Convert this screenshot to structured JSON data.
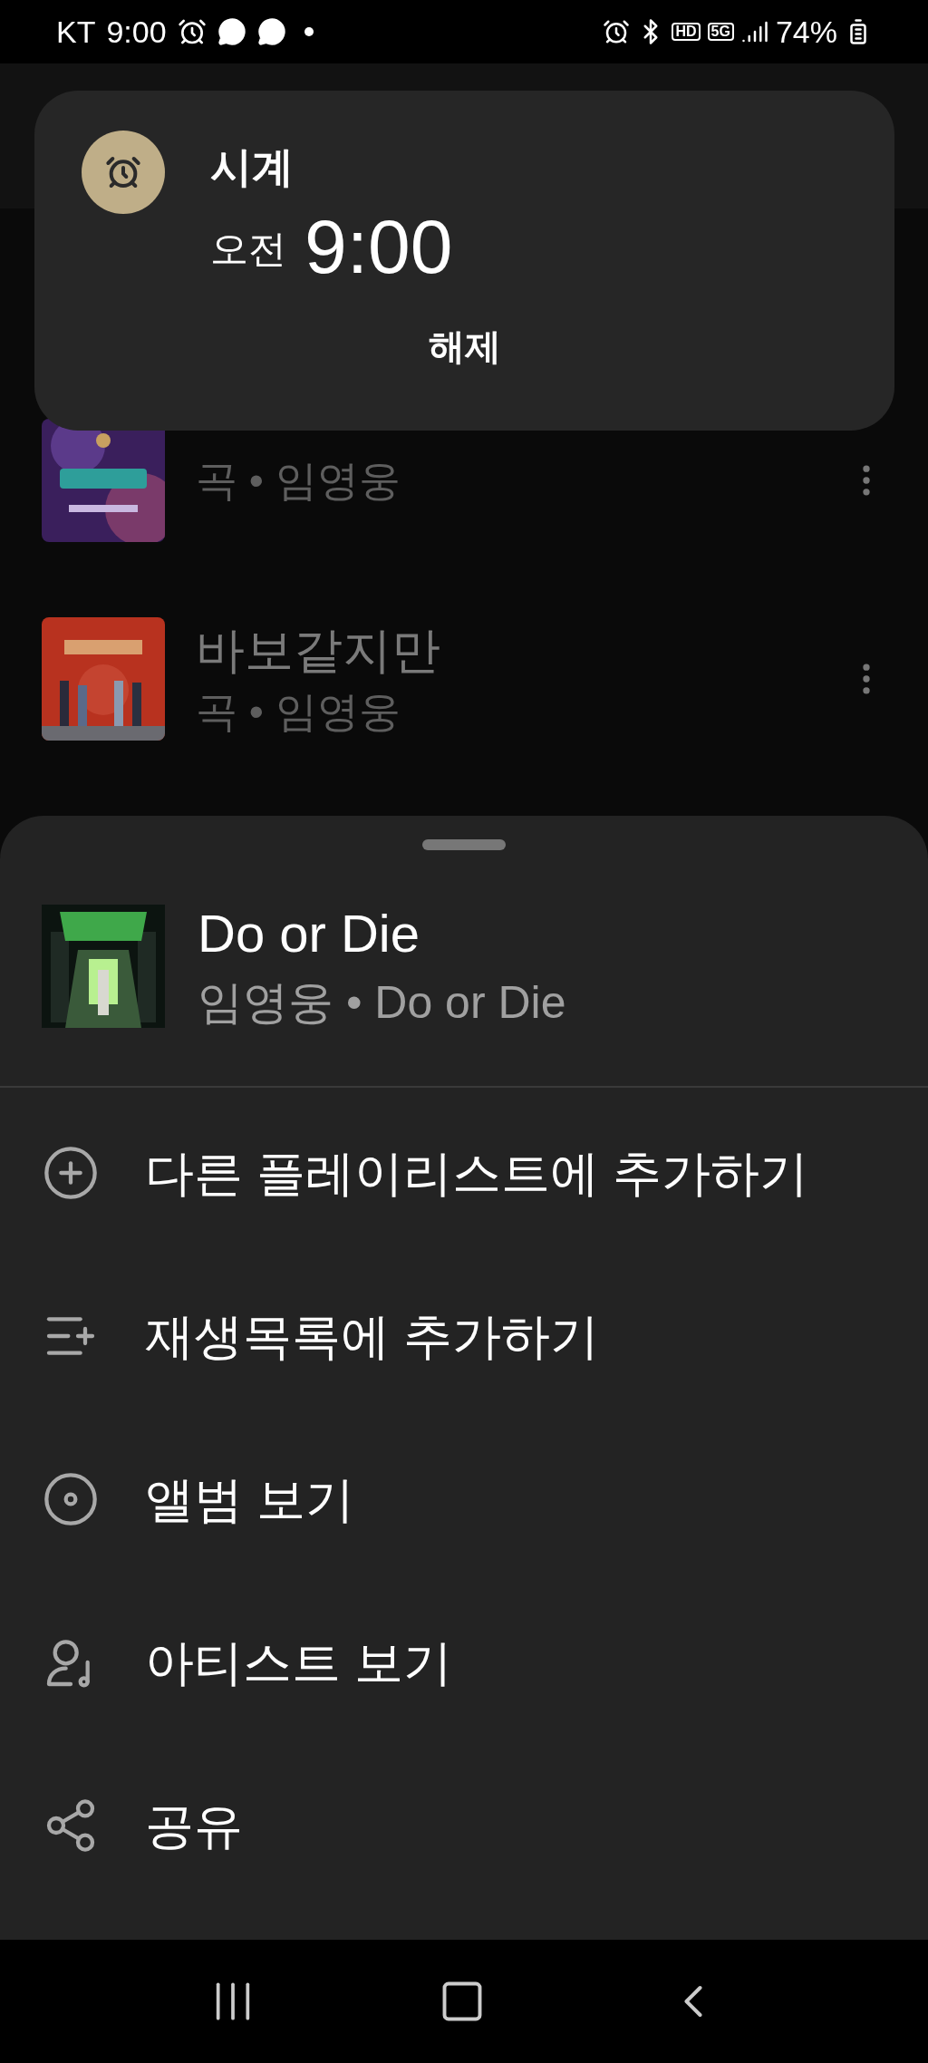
{
  "status_bar": {
    "carrier": "KT",
    "time": "9:00",
    "hd": "HD",
    "network": "5G",
    "battery": "74%"
  },
  "notification": {
    "app": "시계",
    "meridiem": "오전",
    "time": "9:00",
    "action": "해제"
  },
  "background_list": [
    {
      "subtitle": "곡 • 임영웅"
    },
    {
      "title": "바보같지만",
      "subtitle": "곡 • 임영웅"
    }
  ],
  "sheet": {
    "title": "Do or Die",
    "subtitle": "임영웅 • Do or Die",
    "actions": [
      {
        "kind": "add-playlist",
        "label": "다른 플레이리스트에 추가하기"
      },
      {
        "kind": "queue",
        "label": "재생목록에 추가하기"
      },
      {
        "kind": "album",
        "label": "앨범 보기"
      },
      {
        "kind": "artist",
        "label": "아티스트 보기"
      },
      {
        "kind": "share",
        "label": "공유"
      }
    ]
  }
}
